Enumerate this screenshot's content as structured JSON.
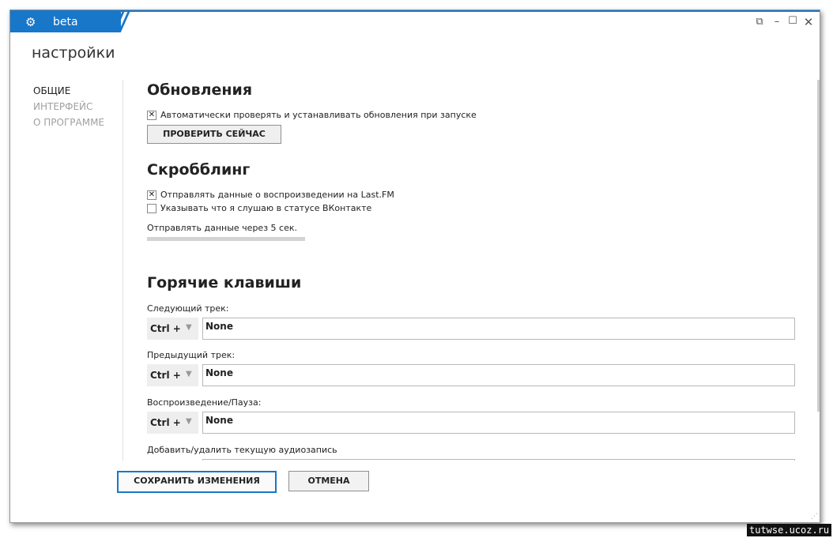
{
  "titlebar": {
    "brand_text": "beta",
    "gear_icon": "gear-icon"
  },
  "window_controls": [
    "restore-icon",
    "minimize-icon",
    "maximize-icon",
    "close-icon"
  ],
  "page_title": "настройки",
  "sidebar": {
    "items": [
      {
        "label": "ОБЩИЕ",
        "active": true
      },
      {
        "label": "ИНТЕРФЕЙС",
        "active": false
      },
      {
        "label": "О ПРОГРАММЕ",
        "active": false
      }
    ]
  },
  "updates": {
    "heading": "Обновления",
    "auto_check": {
      "label": "Автоматически проверять и устанавливать обновления при запуске",
      "checked": true,
      "mark": "✕"
    },
    "check_now_button": "ПРОВЕРИТЬ СЕЙЧАС"
  },
  "scrobbling": {
    "heading": "Скробблинг",
    "lastfm": {
      "label": "Отправлять данные о воспроизведении на Last.FM",
      "checked": true,
      "mark": "✕"
    },
    "vk_status": {
      "label": "Указывать что я слушаю в статусе ВКонтакте",
      "checked": false,
      "mark": ""
    },
    "delay_label": "Отправлять данные через 5 сек."
  },
  "hotkeys": {
    "heading": "Горячие клавиши",
    "items": [
      {
        "label": "Следующий трек:",
        "modifier": "Ctrl +",
        "arrow": "▼",
        "value": "None"
      },
      {
        "label": "Предыдущий трек:",
        "modifier": "Ctrl +",
        "arrow": "▼",
        "value": "None"
      },
      {
        "label": "Воспроизведение/Пауза:",
        "modifier": "Ctrl +",
        "arrow": "▼",
        "value": "None"
      },
      {
        "label": "Добавить/удалить текущую аудиозапись"
      }
    ]
  },
  "footer": {
    "save_button": "СОХРАНИТЬ ИЗМЕНЕНИЯ",
    "cancel_button": "ОТМЕНА"
  },
  "watermark": "tutwse.ucoz.ru",
  "colors": {
    "accent": "#1877c9",
    "border": "#8f8f8f",
    "muted_text": "#a0a0a0"
  }
}
